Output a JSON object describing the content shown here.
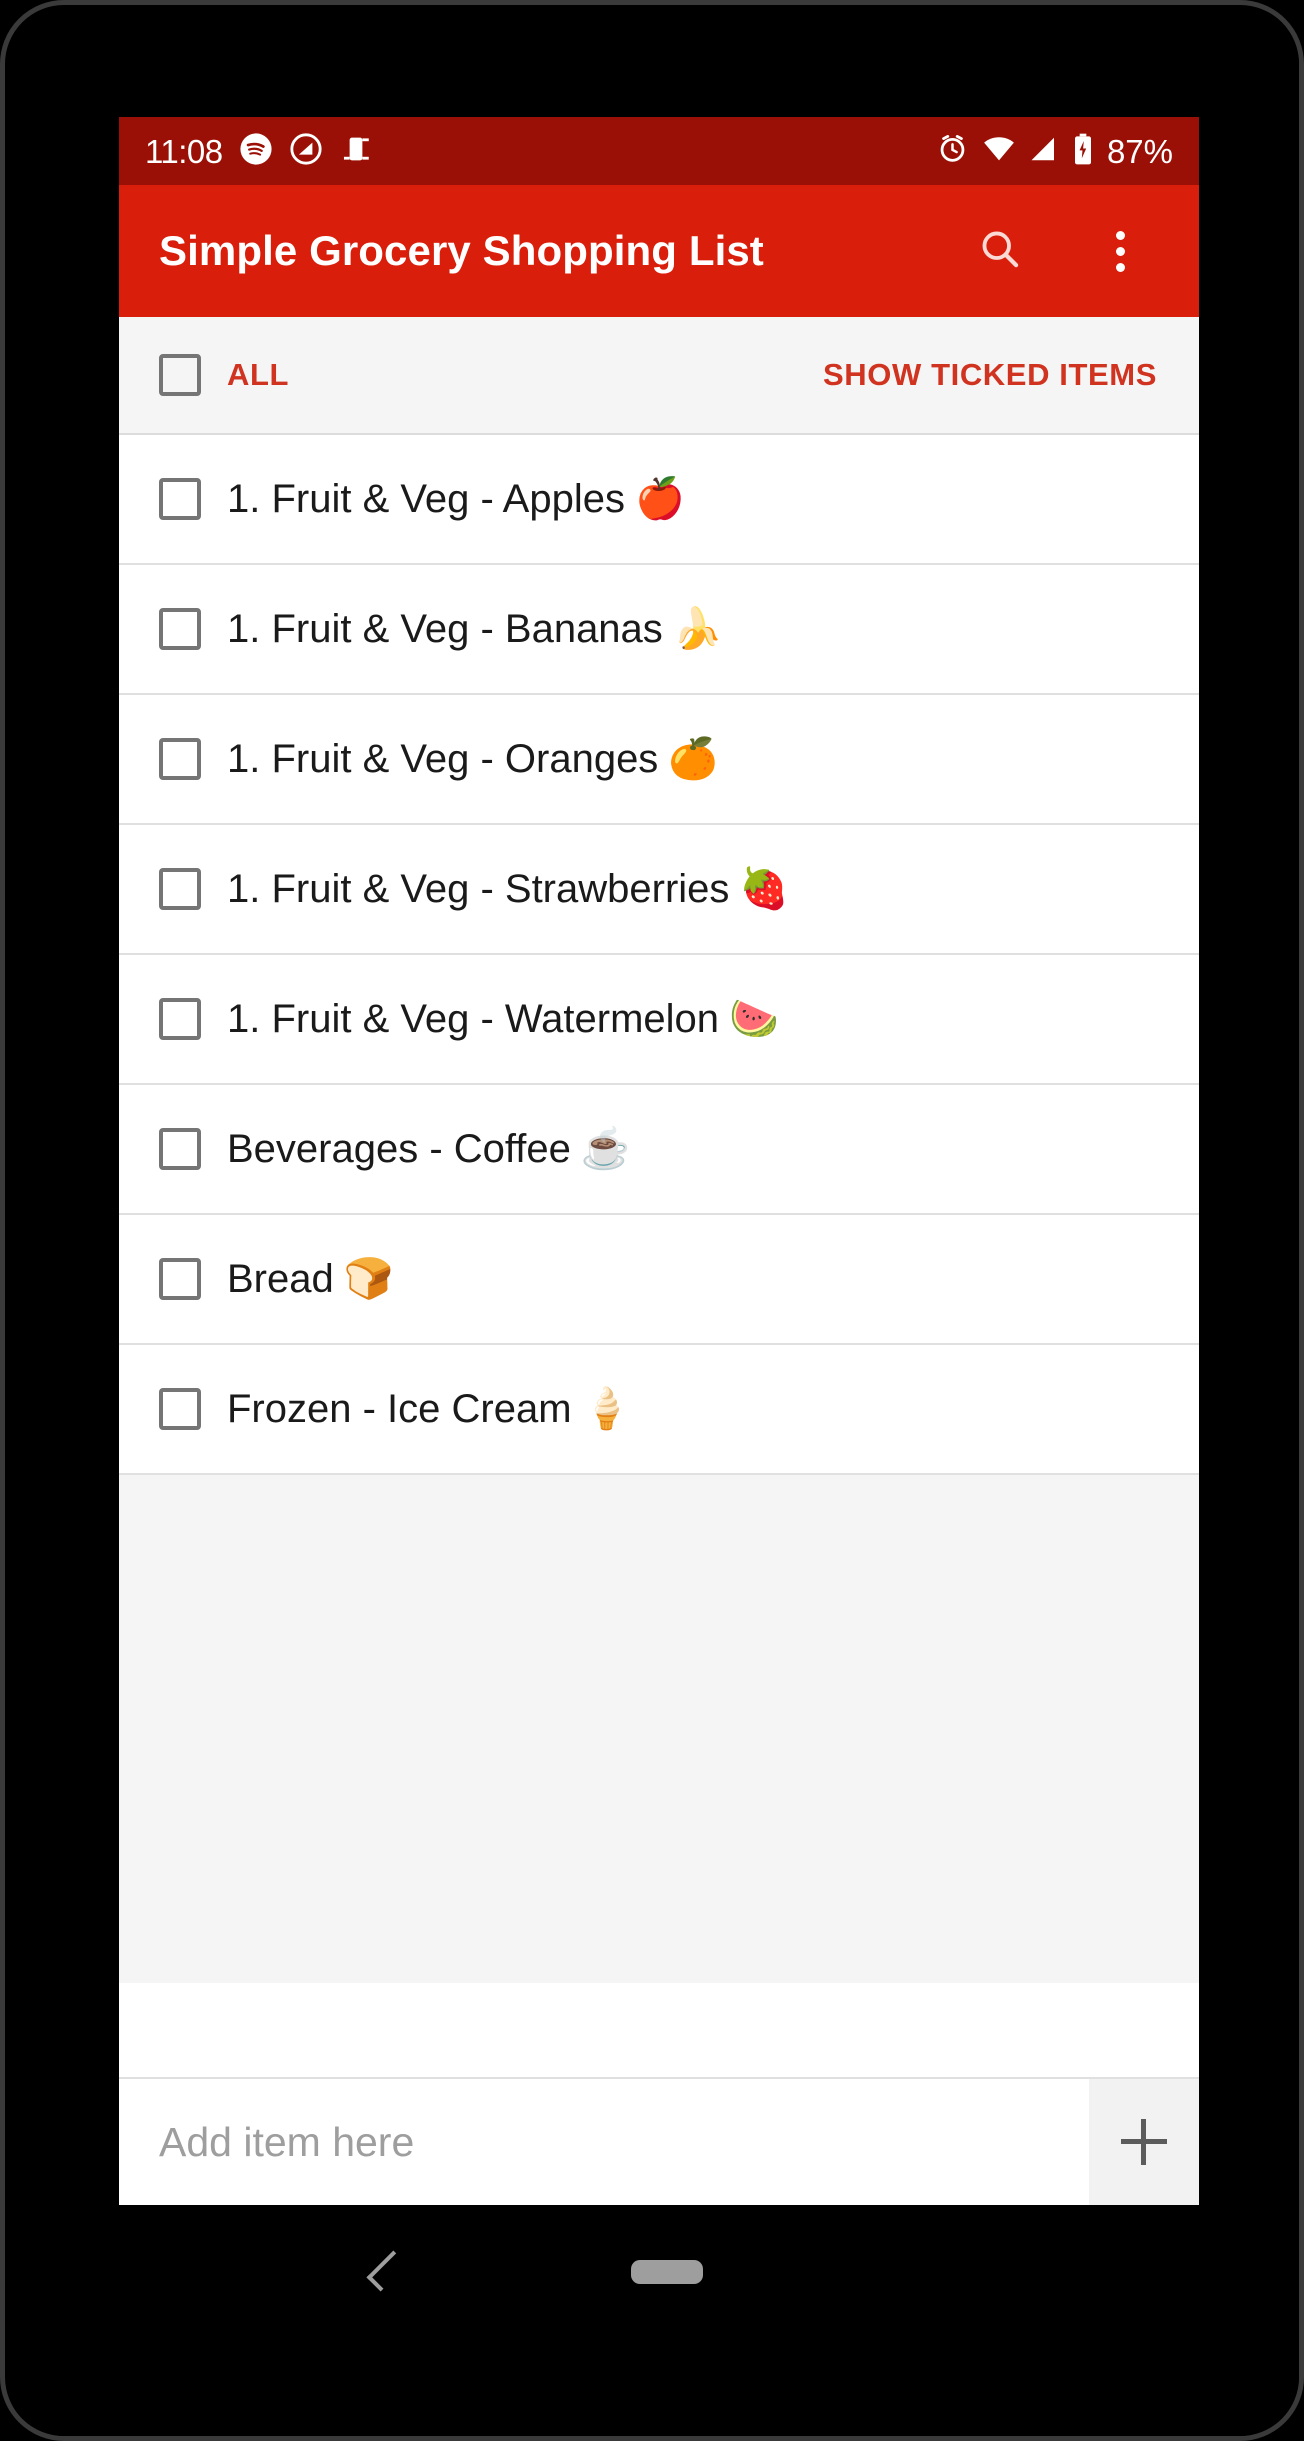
{
  "status_bar": {
    "time": "11:08",
    "battery_percent": "87%",
    "left_icons": [
      "spotify-icon",
      "do-not-disturb-icon",
      "cast-screen-icon"
    ],
    "right_icons": [
      "alarm-icon",
      "wifi-icon",
      "cellular-signal-icon",
      "battery-charging-icon"
    ],
    "background_color": "#9B1006"
  },
  "app_bar": {
    "title": "Simple Grocery Shopping List",
    "background_color": "#D91F0B",
    "search_icon": "search-icon",
    "overflow_icon": "more-vert-icon"
  },
  "filter_bar": {
    "all_label": "ALL",
    "all_checked": false,
    "show_ticked_label": "SHOW TICKED ITEMS",
    "accent_color": "#D0331F",
    "background_color": "#F5F5F5"
  },
  "list": {
    "items": [
      {
        "label": "1. Fruit & Veg - Apples",
        "emoji": "🍎",
        "checked": false
      },
      {
        "label": "1. Fruit & Veg - Bananas",
        "emoji": "🍌",
        "checked": false
      },
      {
        "label": "1. Fruit & Veg - Oranges",
        "emoji": "🍊",
        "checked": false
      },
      {
        "label": "1. Fruit & Veg - Strawberries",
        "emoji": "🍓",
        "checked": false
      },
      {
        "label": "1. Fruit & Veg - Watermelon",
        "emoji": "🍉",
        "checked": false
      },
      {
        "label": "Beverages - Coffee",
        "emoji": "☕",
        "checked": false
      },
      {
        "label": "Bread",
        "emoji": "🍞",
        "checked": false
      },
      {
        "label": "Frozen - Ice Cream",
        "emoji": "🍦",
        "checked": false
      }
    ]
  },
  "add_bar": {
    "placeholder": "Add item here",
    "value": "",
    "add_icon": "plus-icon"
  },
  "nav_bar": {
    "back_icon": "back-chevron-icon",
    "home_icon": "home-pill-icon"
  }
}
